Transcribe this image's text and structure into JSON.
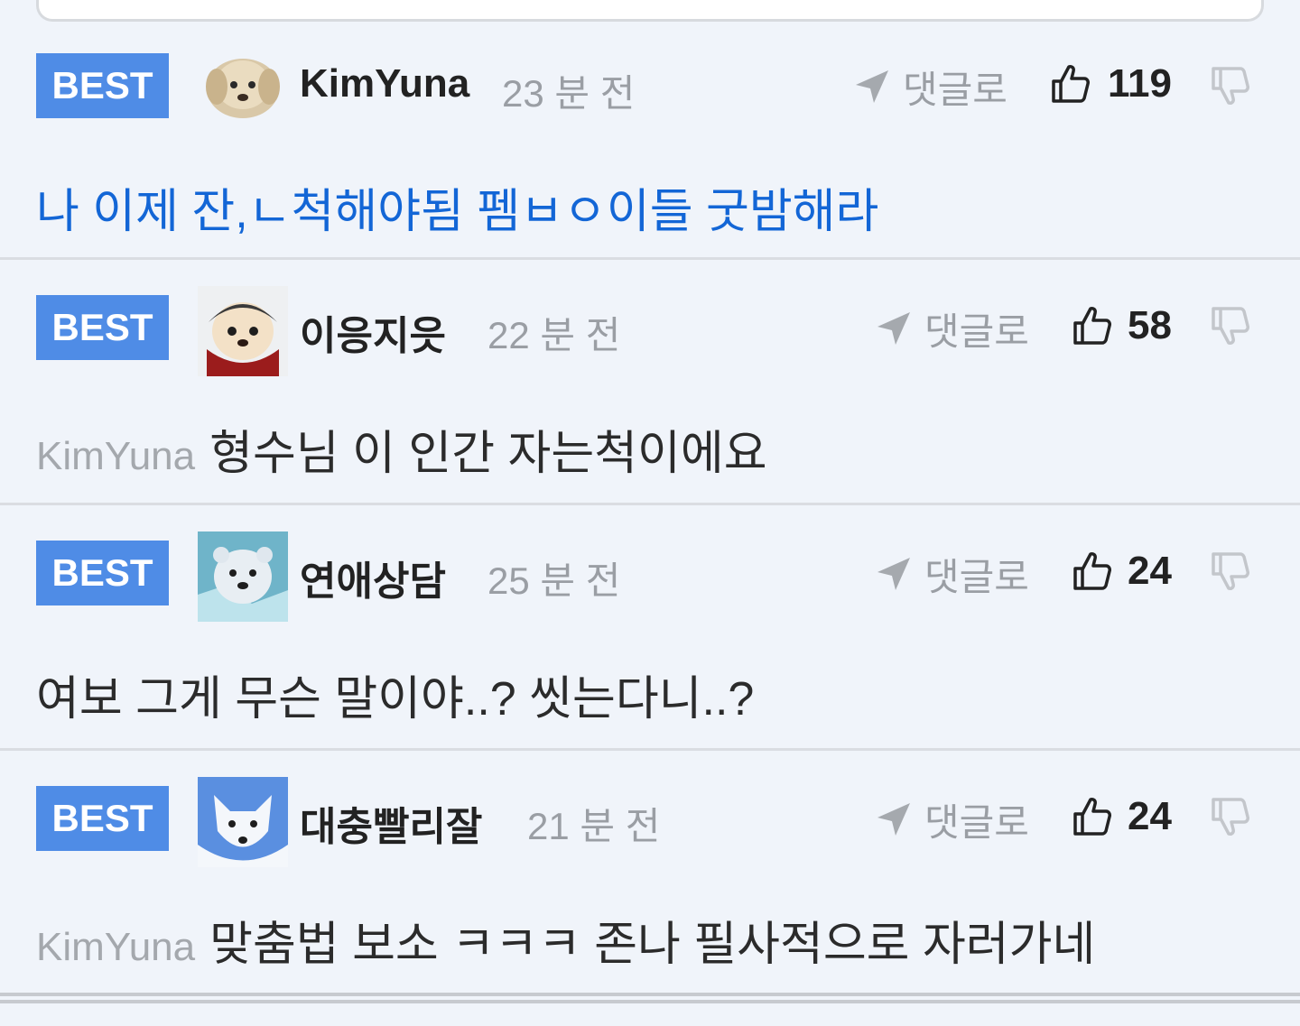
{
  "comments": [
    {
      "badge": "BEST",
      "avatar": "puppy-avatar",
      "username": "KimYuna",
      "time": "23 분 전",
      "reply_label": "댓글로",
      "likes": "119",
      "mention": "",
      "text": "나 이제 잔,ㄴ척해야됨 펨ㅂㅇ이들 굿밤해라"
    },
    {
      "badge": "BEST",
      "avatar": "puppy-red-cape-avatar",
      "username": "이응지읏",
      "time": "22 분 전",
      "reply_label": "댓글로",
      "likes": "58",
      "mention": "KimYuna",
      "text": "형수님 이 인간 자는척이에요"
    },
    {
      "badge": "BEST",
      "avatar": "polar-bear-avatar",
      "username": "연애상담",
      "time": "25 분 전",
      "reply_label": "댓글로",
      "likes": "24",
      "mention": "",
      "text": "여보 그게 무슨 말이야..? 씻는다니..?"
    },
    {
      "badge": "BEST",
      "avatar": "white-fox-avatar",
      "username": "대충빨리잘",
      "time": "21 분 전",
      "reply_label": "댓글로",
      "likes": "24",
      "mention": "KimYuna",
      "text": "맞춤법 보소 ㅋㅋㅋ 존나 필사적으로 자러가네"
    }
  ],
  "colors": {
    "badge_bg": "#4f8ce6",
    "highlight_text": "#1366d6",
    "background": "#f0f4fa",
    "muted": "#9a9ea4"
  }
}
